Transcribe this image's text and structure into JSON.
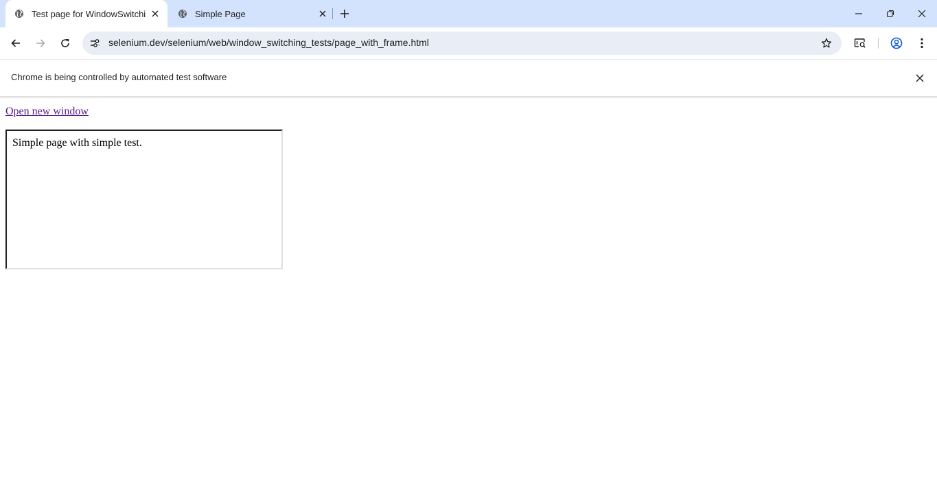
{
  "browser": {
    "tabs": [
      {
        "title": "Test page for WindowSwitching",
        "active": true
      },
      {
        "title": "Simple Page",
        "active": false
      }
    ],
    "address_bar": {
      "url": "selenium.dev/selenium/web/window_switching_tests/page_with_frame.html"
    },
    "infobar": {
      "message": "Chrome is being controlled by automated test software"
    }
  },
  "page": {
    "link_text": "Open new window",
    "frame": {
      "text": "Simple page with simple test."
    }
  },
  "colors": {
    "tabstrip": "#d3e3fd",
    "omnibox": "#e9eef6",
    "visited_link": "#551a8b"
  },
  "icons": [
    "globe-icon",
    "close-icon",
    "plus-icon",
    "minimize-icon",
    "restore-icon",
    "back-icon",
    "forward-icon",
    "reload-icon",
    "site-info-icon",
    "star-icon",
    "reading-mode-icon",
    "profile-icon",
    "more-icon"
  ]
}
